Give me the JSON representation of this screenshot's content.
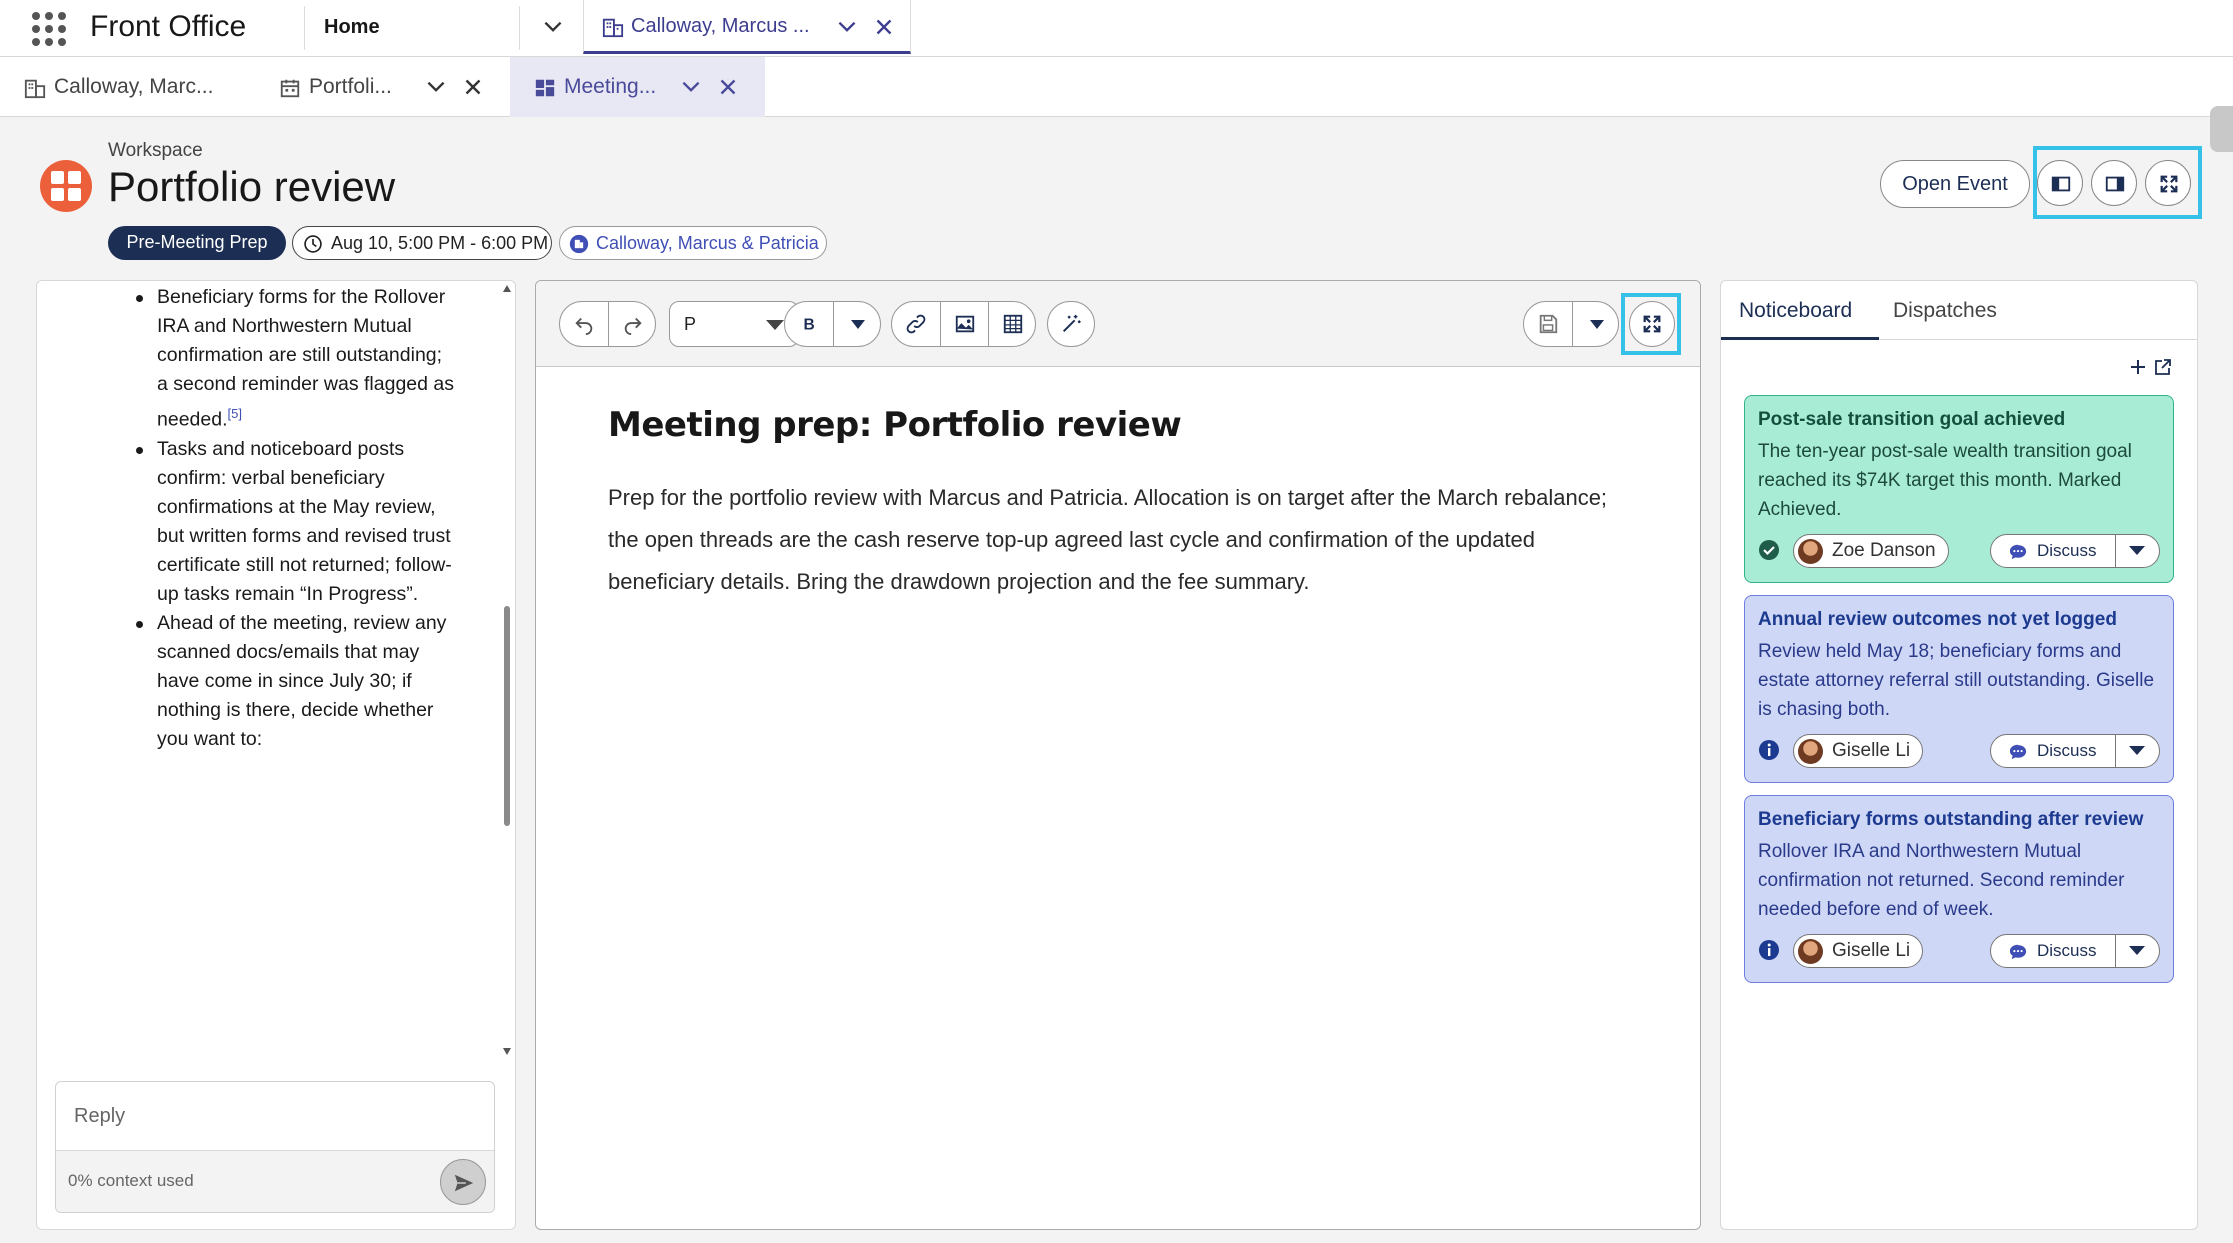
{
  "app": {
    "name": "Front Office"
  },
  "top_tabs": {
    "home": "Home",
    "active": {
      "label": "Calloway, Marcus ...",
      "icon": "building-icon"
    }
  },
  "sub_tabs": [
    {
      "label": "Calloway, Marc...",
      "icon": "building-icon"
    },
    {
      "label": "Portfoli...",
      "icon": "calendar-icon"
    },
    {
      "label": "Meeting...",
      "icon": "workspace-icon",
      "active": true
    }
  ],
  "header": {
    "workspace_label": "Workspace",
    "title": "Portfolio review",
    "stage": "Pre-Meeting Prep",
    "time": "Aug 10, 5:00 PM - 6:00 PM",
    "account": "Calloway, Marcus & Patricia",
    "open_event": "Open Event"
  },
  "left_panel": {
    "bullets": [
      {
        "text": "Beneficiary forms for the Rollover IRA and Northwestern Mutual confirmation are still outstanding; a second reminder was flagged as needed.",
        "ref": "[5]"
      },
      {
        "text": "Tasks and noticeboard posts confirm: verbal beneficiary confirmations at the May review, but written forms and revised trust certificate still not returned; follow-up tasks remain “In Progress”.",
        "ref": ""
      },
      {
        "text": "Ahead of the meeting, review any scanned docs/emails that may have come in since July 30; if nothing is there, decide whether you want to:",
        "ref": ""
      }
    ],
    "reply_placeholder": "Reply",
    "context_used": "0% context used"
  },
  "editor": {
    "toolbar": {
      "paragraph_style": "P"
    },
    "doc_title": "Meeting prep: Portfolio review",
    "doc_body": "Prep for the portfolio review with Marcus and Patricia. Allocation is on target after the March rebalance; the open threads are the cash reserve top-up agreed last cycle and confirmation of the updated beneficiary details. Bring the drawdown projection and the fee summary."
  },
  "right_panel": {
    "tabs": [
      "Noticeboard",
      "Dispatches"
    ],
    "cards": [
      {
        "title": "Post-sale transition goal achieved",
        "body": "The ten-year post-sale wealth transition goal reached its $74K target this month. Marked Achieved.",
        "person": "Zoe Danson",
        "status": "check",
        "discuss": "Discuss",
        "color": "#a8ecd6"
      },
      {
        "title": "Annual review outcomes not yet logged",
        "body": "Review held May 18; beneficiary forms and estate attorney referral still outstanding. Giselle is chasing both.",
        "person": "Giselle Li",
        "status": "info",
        "discuss": "Discuss",
        "color": "#cfd7f6"
      },
      {
        "title": "Beneficiary forms outstanding after review",
        "body": "Rollover IRA and Northwestern Mutual confirmation not returned. Second reminder needed before end of week.",
        "person": "Giselle Li",
        "status": "info",
        "discuss": "Discuss",
        "color": "#cfd7f6"
      }
    ]
  },
  "colors": {
    "accent": "#1c2e54",
    "highlight": "#36c2e8",
    "brand_logo": "#ec5f3b"
  }
}
